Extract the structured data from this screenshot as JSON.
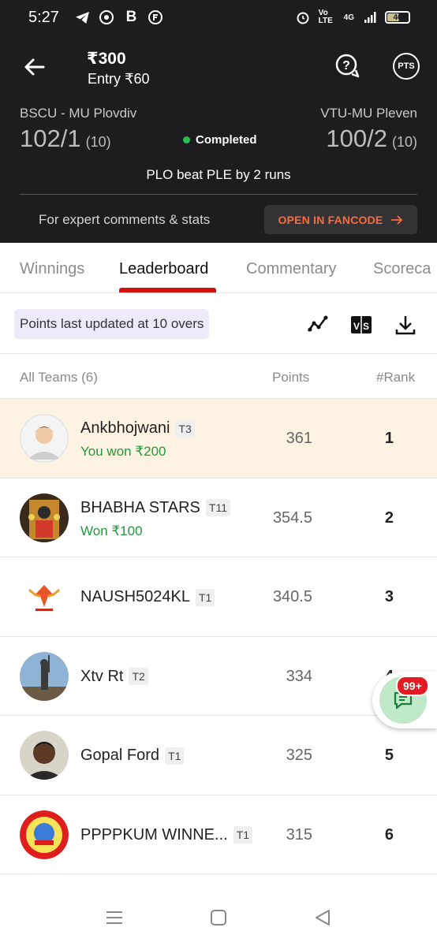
{
  "status_bar": {
    "time": "5:27",
    "volte": "Vo LTE",
    "network": "4G",
    "battery": "46"
  },
  "header": {
    "prize": "₹300",
    "entry": "Entry ₹60",
    "team_a": {
      "name": "BSCU - MU Plovdiv",
      "score": "102/1",
      "overs": "(10)"
    },
    "team_b": {
      "name": "VTU-MU Pleven",
      "score": "100/2",
      "overs": "(10)"
    },
    "match_status": "Completed",
    "result": "PLO beat PLE by 2 runs",
    "expert_text": "For expert comments & stats",
    "fancode_button": "OPEN IN FANCODE"
  },
  "tabs": [
    "Winnings",
    "Leaderboard",
    "Commentary",
    "Scoreca"
  ],
  "toolbar": {
    "updated_text": "Points last updated at 10 overs"
  },
  "columns": {
    "teams": "All Teams (6)",
    "points": "Points",
    "rank": "#Rank"
  },
  "rows": [
    {
      "name": "Ankbhojwani",
      "tag": "T3",
      "won": "You won ₹200",
      "points": "361",
      "rank": "1"
    },
    {
      "name": "BHABHA STARS",
      "tag": "T11",
      "won": "Won ₹100",
      "points": "354.5",
      "rank": "2"
    },
    {
      "name": "NAUSH5024KL",
      "tag": "T1",
      "won": "",
      "points": "340.5",
      "rank": "3"
    },
    {
      "name": "Xtv Rt",
      "tag": "T2",
      "won": "",
      "points": "334",
      "rank": "4"
    },
    {
      "name": "Gopal Ford",
      "tag": "T1",
      "won": "",
      "points": "325",
      "rank": "5"
    },
    {
      "name": "PPPPKUM WINNE...",
      "tag": "T1",
      "won": "",
      "points": "315",
      "rank": "6"
    }
  ],
  "chat": {
    "badge": "99+"
  },
  "colors": {
    "accent": "#d31010",
    "success": "#1e9a3a",
    "fancode": "#ff6a3d",
    "header_bg": "#1d1d1f"
  }
}
